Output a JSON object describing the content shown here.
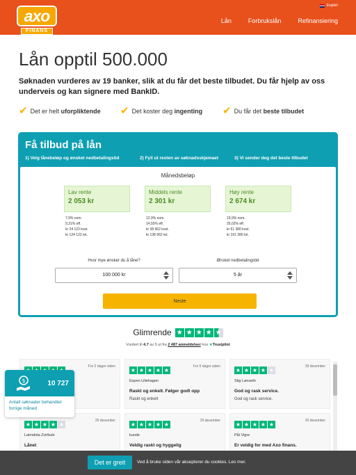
{
  "header": {
    "logo_text": "axo",
    "logo_subtext": "FINANS",
    "language": "English",
    "nav": [
      "Lån",
      "Forbrukslån",
      "Refinansiering"
    ],
    "bg_color": "#e8501c"
  },
  "intro": {
    "title": "Lån opptil 500.000",
    "lead": "Søknaden vurderes av 19 banker, slik at du får det beste tilbudet. Du får hjelp av oss underveis og kan signere med BankID.",
    "perks": [
      {
        "prefix": "Det er helt ",
        "bold": "uforpliktende"
      },
      {
        "prefix": "Det koster deg ",
        "bold": "ingenting"
      },
      {
        "prefix": "Du får det ",
        "bold": "beste tilbudet"
      }
    ],
    "perk_icon": "check-icon"
  },
  "offer": {
    "title": "Få tilbud på lån",
    "steps": [
      "1) Velg lånebeløp og ønsket nedbetalingstid",
      "2) Fyll ut resten av søknadsskjemaet",
      "3) Vi sender deg det beste tilbudet"
    ],
    "monthly_label": "Månedsbeløp",
    "rates": [
      {
        "label": "Lav rente",
        "amount": "2 053 kr",
        "details": [
          "7,9% nom.",
          "9,31% eff.",
          "kr 24 122 kost.",
          "kr 124 122 tot."
        ]
      },
      {
        "label": "Middels rente",
        "amount": "2 301 kr",
        "details": [
          "12,9% nom.",
          "14,55% eff.",
          "kr 38 962 kost.",
          "kr 138 962 tot."
        ]
      },
      {
        "label": "Høy rente",
        "amount": "2 674 kr",
        "details": [
          "19,9% nom.",
          "25,02% eff.",
          "kr 61 380 kost.",
          "kr 161 380 tot."
        ]
      }
    ],
    "amount_label": "Hvor mye ønsker du å låne?",
    "amount_value": "100 000 kr",
    "term_label": "Ønsket nedbetalingstid",
    "term_value": "5 år",
    "submit_label": "Neste",
    "accent_color": "#0e9fb3",
    "button_color": "#f6b400"
  },
  "trustpilot": {
    "rating_word": "Glimrende",
    "stars": 4.5,
    "sub_prefix": "Vurdert til ",
    "score": "4.7",
    "sub_mid": " av 5 ut fra ",
    "review_count": "2 487 anmeldelser",
    "sub_suffix": " hos ",
    "brand": "Trustpilot"
  },
  "reviews": [
    {
      "stars": 5,
      "date": "For 2 dager siden",
      "name": "",
      "title": "",
      "text": ""
    },
    {
      "stars": 5,
      "date": "For 5 dager siden",
      "name": "Espen Lillehagen",
      "title": "Raskt og enkelt. Følger godt opp",
      "text": "Raskt og enkelt"
    },
    {
      "stars": 4,
      "date": "29 desember",
      "name": "Stig Lønseth",
      "title": "God og rask service.",
      "text": "God og rask service."
    },
    {
      "stars": 4,
      "date": "25 desember",
      "name": "Laimdota Zvirbule",
      "title": "Lånet",
      "text": ""
    },
    {
      "stars": 5,
      "date": "25 desember",
      "name": "kunde",
      "title": "Veldig raskt og hyggelig",
      "text": ""
    },
    {
      "stars": 5,
      "date": "20 desember",
      "name": "Pål Vigre",
      "title": "Er veldig for med Axo finans.",
      "text": ""
    }
  ],
  "widget": {
    "count": "10 727",
    "label": "Antall søknader behandlet forrige måned",
    "icon": "money-hand-icon"
  },
  "cookie": {
    "button": "Det er greit",
    "text_prefix": "Ved å bruke siden vår aksepterer du cookies. ",
    "link": "Les mer."
  }
}
